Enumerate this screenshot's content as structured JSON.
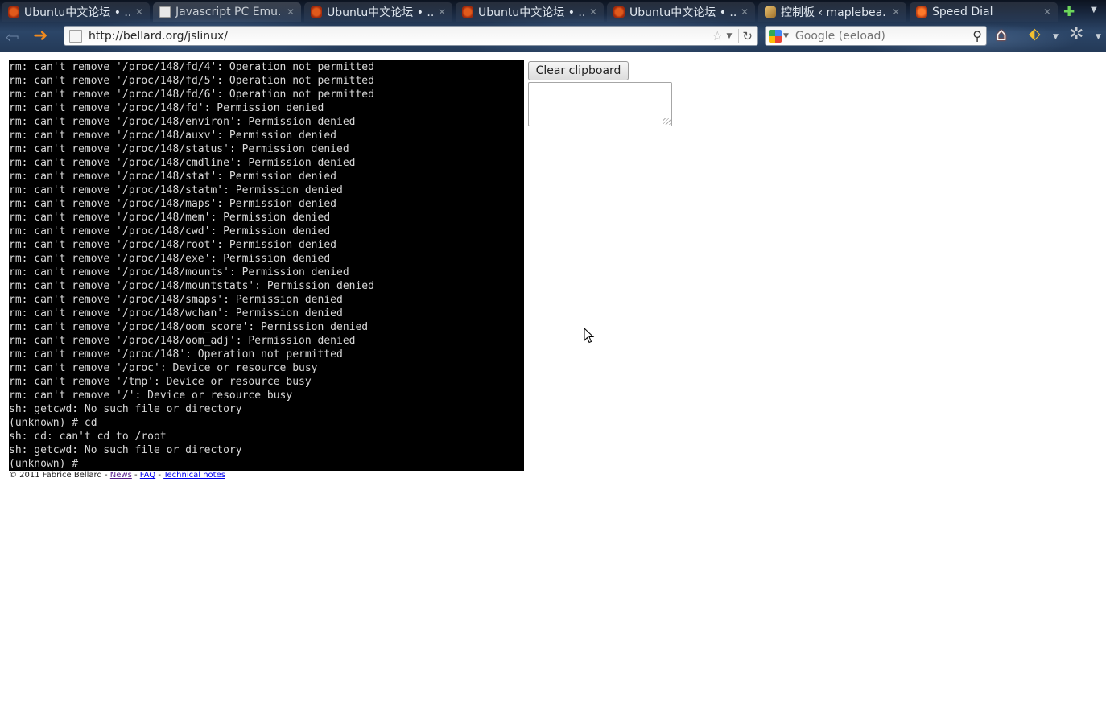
{
  "browser": {
    "tabs": [
      {
        "title": "Ubuntu中文论坛 • ...",
        "favicon": "ubuntu-forum-icon",
        "active": false
      },
      {
        "title": "Javascript PC Emu...",
        "favicon": "page-icon",
        "active": true
      },
      {
        "title": "Ubuntu中文论坛 • ...",
        "favicon": "ubuntu-forum-icon",
        "active": false
      },
      {
        "title": "Ubuntu中文论坛 • ...",
        "favicon": "ubuntu-forum-icon",
        "active": false
      },
      {
        "title": "Ubuntu中文论坛 • ...",
        "favicon": "ubuntu-forum-icon",
        "active": false
      },
      {
        "title": "控制板 ‹ maplebea...",
        "favicon": "wordpress-icon",
        "active": false
      },
      {
        "title": "Speed Dial",
        "favicon": "speed-dial-icon",
        "active": false
      }
    ],
    "address": "http://bellard.org/jslinux/",
    "search_placeholder": "Google (eeload)",
    "icons": {
      "back": "back-arrow-icon",
      "forward": "forward-arrow-icon",
      "star": "bookmark-star-icon",
      "reload": "reload-icon",
      "search": "magnifier-icon",
      "home": "home-icon",
      "new_tab": "plus-icon",
      "menu": "menu-icon"
    },
    "colors": {
      "forward_arrow": "#f08a1e",
      "new_tab": "#6cd65a"
    }
  },
  "terminal": {
    "lines": [
      "rm: can't remove '/proc/148/fd/4': Operation not permitted",
      "rm: can't remove '/proc/148/fd/5': Operation not permitted",
      "rm: can't remove '/proc/148/fd/6': Operation not permitted",
      "rm: can't remove '/proc/148/fd': Permission denied",
      "rm: can't remove '/proc/148/environ': Permission denied",
      "rm: can't remove '/proc/148/auxv': Permission denied",
      "rm: can't remove '/proc/148/status': Permission denied",
      "rm: can't remove '/proc/148/cmdline': Permission denied",
      "rm: can't remove '/proc/148/stat': Permission denied",
      "rm: can't remove '/proc/148/statm': Permission denied",
      "rm: can't remove '/proc/148/maps': Permission denied",
      "rm: can't remove '/proc/148/mem': Permission denied",
      "rm: can't remove '/proc/148/cwd': Permission denied",
      "rm: can't remove '/proc/148/root': Permission denied",
      "rm: can't remove '/proc/148/exe': Permission denied",
      "rm: can't remove '/proc/148/mounts': Permission denied",
      "rm: can't remove '/proc/148/mountstats': Permission denied",
      "rm: can't remove '/proc/148/smaps': Permission denied",
      "rm: can't remove '/proc/148/wchan': Permission denied",
      "rm: can't remove '/proc/148/oom_score': Permission denied",
      "rm: can't remove '/proc/148/oom_adj': Permission denied",
      "rm: can't remove '/proc/148': Operation not permitted",
      "rm: can't remove '/proc': Device or resource busy",
      "rm: can't remove '/tmp': Device or resource busy",
      "rm: can't remove '/': Device or resource busy",
      "sh: getcwd: No such file or directory",
      "(unknown) # cd",
      "sh: cd: can't cd to /root",
      "sh: getcwd: No such file or directory",
      "(unknown) # "
    ],
    "colors": {
      "background": "#000000",
      "foreground": "#d8d8d8"
    }
  },
  "clipboard": {
    "button_label": "Clear clipboard",
    "value": ""
  },
  "footer": {
    "copyright": "© 2011 Fabrice Bellard - ",
    "links": [
      "News",
      "FAQ",
      "Technical notes"
    ],
    "separator": " - "
  }
}
